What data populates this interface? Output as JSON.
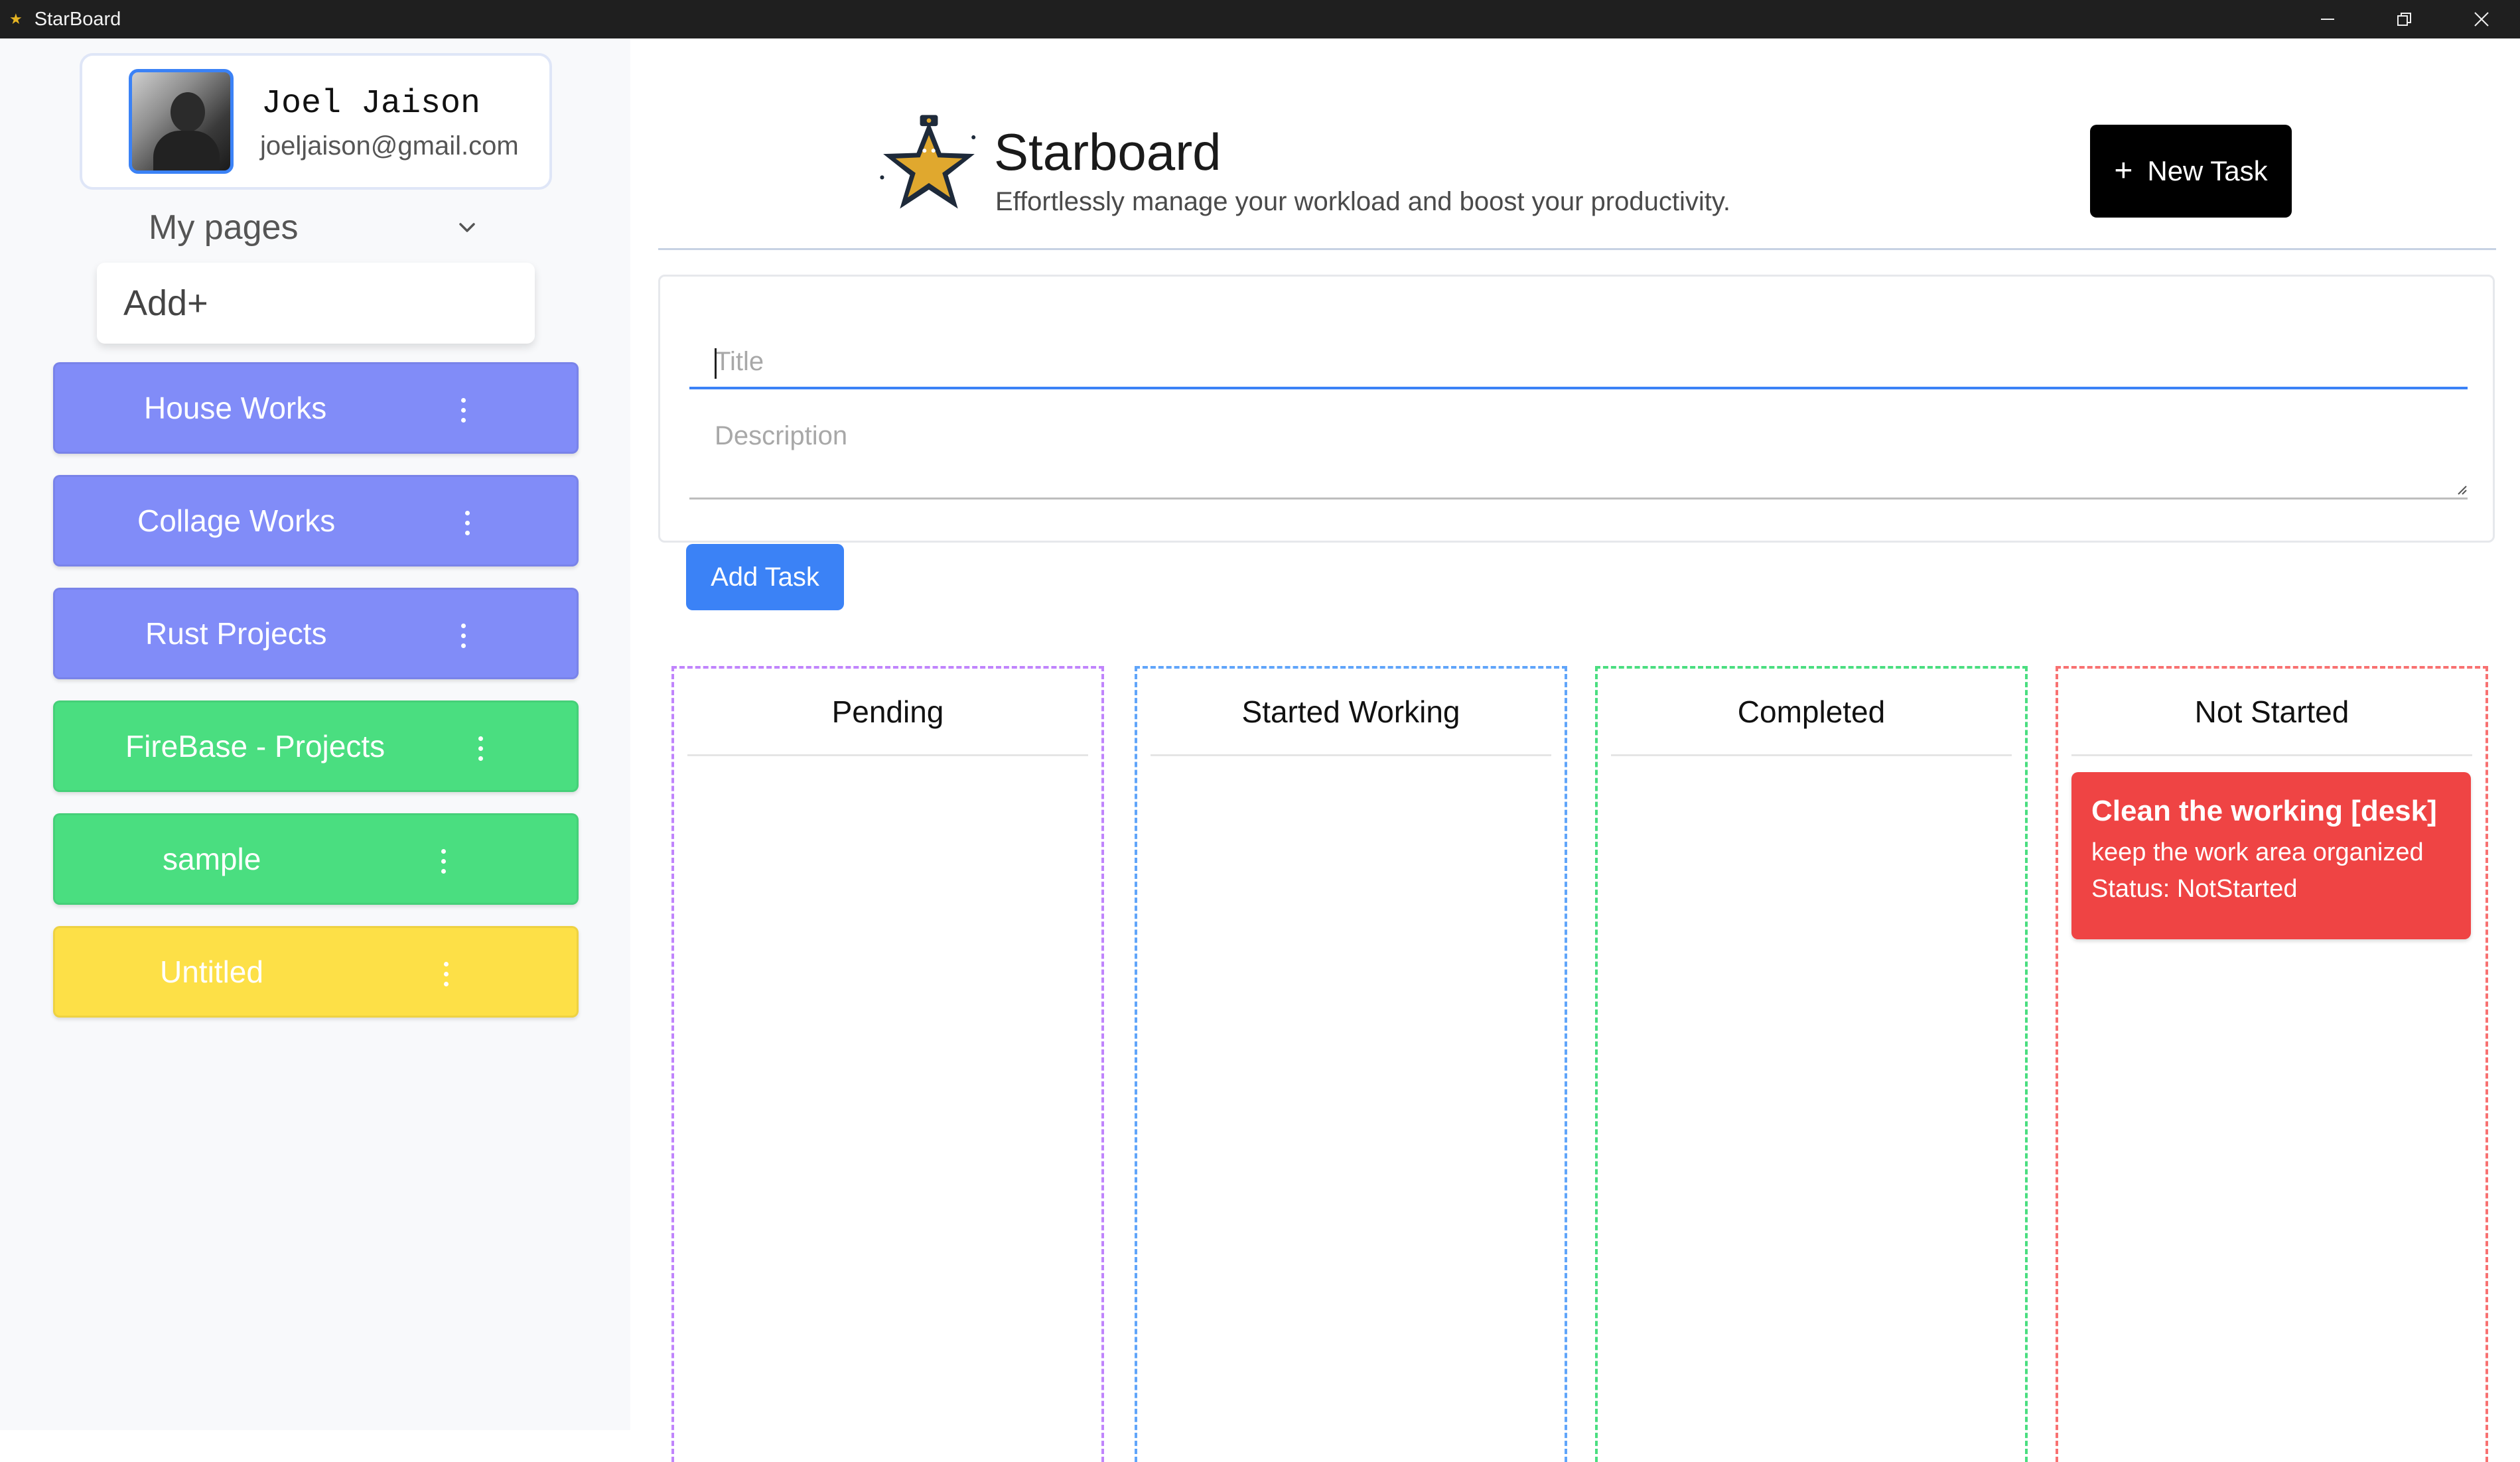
{
  "window": {
    "title": "StarBoard"
  },
  "profile": {
    "name": "Joel Jaison",
    "email": "joeljaison@gmail.com"
  },
  "sidebar": {
    "my_pages_label": "My pages",
    "add_label": "Add+",
    "pages": [
      {
        "label": "House Works",
        "color": "#818cf8"
      },
      {
        "label": "Collage Works",
        "color": "#818cf8"
      },
      {
        "label": "Rust Projects",
        "color": "#818cf8"
      },
      {
        "label": "FireBase - Projects",
        "color": "#4ade80"
      },
      {
        "label": "sample",
        "color": "#4ade80"
      },
      {
        "label": "Untitled",
        "color": "#fde047"
      }
    ]
  },
  "header": {
    "brand": "Starboard",
    "tagline": "Effortlessly manage your workload and boost your productivity.",
    "new_task_label": "New Task"
  },
  "form": {
    "title_placeholder": "Title",
    "description_placeholder": "Description",
    "add_task_label": "Add Task"
  },
  "board": {
    "columns": [
      {
        "title": "Pending",
        "border_color": "#c084fc"
      },
      {
        "title": "Started Working",
        "border_color": "#60a5fa"
      },
      {
        "title": "Completed",
        "border_color": "#4ade80"
      },
      {
        "title": "Not Started",
        "border_color": "#f87171"
      }
    ],
    "not_started_tasks": [
      {
        "title": "Clean the working [desk]",
        "description": "keep the work area organized",
        "status": "Status: NotStarted",
        "color": "#ef4444"
      }
    ]
  }
}
